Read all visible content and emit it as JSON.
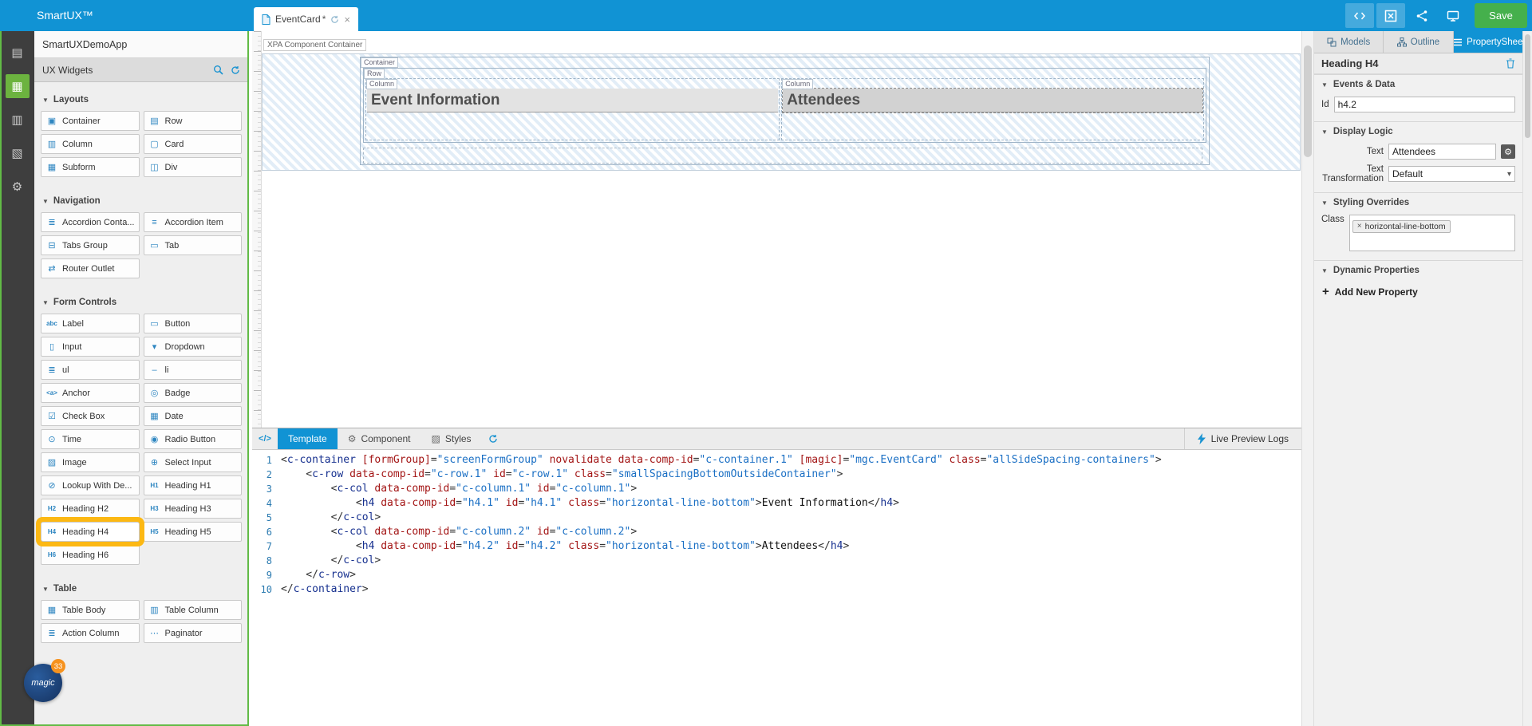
{
  "topbar": {
    "title": "SmartUX™",
    "doc_tab": {
      "label": "EventCard",
      "modified": "*"
    },
    "save_label": "Save"
  },
  "footer": {
    "logo_text": "magic",
    "badge": "33"
  },
  "widget_panel": {
    "app_name": "SmartUXDemoApp",
    "title": "UX Widgets",
    "sections": [
      {
        "label": "Layouts",
        "items": [
          {
            "label": "Container",
            "glyph": "▣",
            "icon": "container-icon"
          },
          {
            "label": "Row",
            "glyph": "▤",
            "icon": "row-icon"
          },
          {
            "label": "Column",
            "glyph": "▥",
            "icon": "column-icon"
          },
          {
            "label": "Card",
            "glyph": "▢",
            "icon": "card-icon"
          },
          {
            "label": "Subform",
            "glyph": "▦",
            "icon": "subform-icon"
          },
          {
            "label": "Div",
            "glyph": "◫",
            "icon": "div-icon"
          }
        ]
      },
      {
        "label": "Navigation",
        "items": [
          {
            "label": "Accordion Conta...",
            "glyph": "≣",
            "icon": "accordion-container-icon"
          },
          {
            "label": "Accordion Item",
            "glyph": "≡",
            "icon": "accordion-item-icon"
          },
          {
            "label": "Tabs Group",
            "glyph": "⊟",
            "icon": "tabs-group-icon"
          },
          {
            "label": "Tab",
            "glyph": "▭",
            "icon": "tab-icon"
          },
          {
            "label": "Router Outlet",
            "glyph": "⇄",
            "icon": "router-outlet-icon"
          }
        ]
      },
      {
        "label": "Form Controls",
        "items": [
          {
            "label": "Label",
            "glyph": "abc",
            "icon": "label-icon",
            "txt": true
          },
          {
            "label": "Button",
            "glyph": "▭",
            "icon": "button-icon"
          },
          {
            "label": "Input",
            "glyph": "▯",
            "icon": "input-icon"
          },
          {
            "label": "Dropdown",
            "glyph": "▾",
            "icon": "dropdown-icon"
          },
          {
            "label": "ul",
            "glyph": "≣",
            "icon": "unordered-list-icon"
          },
          {
            "label": "li",
            "glyph": "–",
            "icon": "list-item-icon"
          },
          {
            "label": "Anchor",
            "glyph": "<a>",
            "icon": "anchor-icon",
            "txt": true
          },
          {
            "label": "Badge",
            "glyph": "◎",
            "icon": "badge-icon"
          },
          {
            "label": "Check Box",
            "glyph": "☑",
            "icon": "checkbox-icon"
          },
          {
            "label": "Date",
            "glyph": "▦",
            "icon": "date-icon"
          },
          {
            "label": "Time",
            "glyph": "⊙",
            "icon": "time-icon"
          },
          {
            "label": "Radio Button",
            "glyph": "◉",
            "icon": "radio-button-icon"
          },
          {
            "label": "Image",
            "glyph": "▨",
            "icon": "image-icon"
          },
          {
            "label": "Select Input",
            "glyph": "⊕",
            "icon": "select-input-icon"
          },
          {
            "label": "Lookup With De...",
            "glyph": "⊘",
            "icon": "lookup-icon"
          },
          {
            "label": "Heading H1",
            "glyph": "H1",
            "icon": "heading1-icon",
            "txt": true
          },
          {
            "label": "Heading H2",
            "glyph": "H2",
            "icon": "heading2-icon",
            "txt": true
          },
          {
            "label": "Heading H3",
            "glyph": "H3",
            "icon": "heading3-icon",
            "txt": true
          },
          {
            "label": "Heading H4",
            "glyph": "H4",
            "icon": "heading4-icon",
            "txt": true,
            "highlight": true
          },
          {
            "label": "Heading H5",
            "glyph": "H5",
            "icon": "heading5-icon",
            "txt": true
          },
          {
            "label": "Heading H6",
            "glyph": "H6",
            "icon": "heading6-icon",
            "txt": true
          }
        ]
      },
      {
        "label": "Table",
        "items": [
          {
            "label": "Table Body",
            "glyph": "▦",
            "icon": "table-body-icon"
          },
          {
            "label": "Table Column",
            "glyph": "▥",
            "icon": "table-column-icon"
          },
          {
            "label": "Action Column",
            "glyph": "≣",
            "icon": "action-column-icon"
          },
          {
            "label": "Paginator",
            "glyph": "⋯",
            "icon": "paginator-icon"
          }
        ]
      }
    ]
  },
  "canvas": {
    "container_label": "XPA Component Container",
    "chips": {
      "container": "Container",
      "row": "Row",
      "column": "Column"
    },
    "headings": {
      "left": "Event Information",
      "right": "Attendees"
    }
  },
  "code_panel": {
    "template_tab": "Template",
    "component_tab": "Component",
    "styles_tab": "Styles",
    "live_preview": "Live Preview Logs",
    "lines": [
      [
        [
          "p",
          "<"
        ],
        [
          "t",
          "c-container"
        ],
        [
          "p",
          " "
        ],
        [
          "a",
          "[formGroup]"
        ],
        [
          "p",
          "="
        ],
        [
          "v",
          "\"screenFormGroup\""
        ],
        [
          "p",
          " "
        ],
        [
          "a",
          "novalidate"
        ],
        [
          "p",
          " "
        ],
        [
          "a",
          "data-comp-id"
        ],
        [
          "p",
          "="
        ],
        [
          "v",
          "\"c-container.1\""
        ],
        [
          "p",
          " "
        ],
        [
          "a",
          "[magic]"
        ],
        [
          "p",
          "="
        ],
        [
          "v",
          "\"mgc.EventCard\""
        ],
        [
          "p",
          " "
        ],
        [
          "a",
          "class"
        ],
        [
          "p",
          "="
        ],
        [
          "v",
          "\"allSideSpacing-containers\""
        ],
        [
          "p",
          ">"
        ]
      ],
      [
        [
          "p",
          "    <"
        ],
        [
          "t",
          "c-row"
        ],
        [
          "p",
          " "
        ],
        [
          "a",
          "data-comp-id"
        ],
        [
          "p",
          "="
        ],
        [
          "v",
          "\"c-row.1\""
        ],
        [
          "p",
          " "
        ],
        [
          "a",
          "id"
        ],
        [
          "p",
          "="
        ],
        [
          "v",
          "\"c-row.1\""
        ],
        [
          "p",
          " "
        ],
        [
          "a",
          "class"
        ],
        [
          "p",
          "="
        ],
        [
          "v",
          "\"smallSpacingBottomOutsideContainer\""
        ],
        [
          "p",
          ">"
        ]
      ],
      [
        [
          "p",
          "        <"
        ],
        [
          "t",
          "c-col"
        ],
        [
          "p",
          " "
        ],
        [
          "a",
          "data-comp-id"
        ],
        [
          "p",
          "="
        ],
        [
          "v",
          "\"c-column.1\""
        ],
        [
          "p",
          " "
        ],
        [
          "a",
          "id"
        ],
        [
          "p",
          "="
        ],
        [
          "v",
          "\"c-column.1\""
        ],
        [
          "p",
          ">"
        ]
      ],
      [
        [
          "p",
          "            <"
        ],
        [
          "t",
          "h4"
        ],
        [
          "p",
          " "
        ],
        [
          "a",
          "data-comp-id"
        ],
        [
          "p",
          "="
        ],
        [
          "v",
          "\"h4.1\""
        ],
        [
          "p",
          " "
        ],
        [
          "a",
          "id"
        ],
        [
          "p",
          "="
        ],
        [
          "v",
          "\"h4.1\""
        ],
        [
          "p",
          " "
        ],
        [
          "a",
          "class"
        ],
        [
          "p",
          "="
        ],
        [
          "v",
          "\"horizontal-line-bottom\""
        ],
        [
          "p",
          ">"
        ],
        [
          "x",
          "Event Information"
        ],
        [
          "p",
          "</"
        ],
        [
          "t",
          "h4"
        ],
        [
          "p",
          ">"
        ]
      ],
      [
        [
          "p",
          "        </"
        ],
        [
          "t",
          "c-col"
        ],
        [
          "p",
          ">"
        ]
      ],
      [
        [
          "p",
          "        <"
        ],
        [
          "t",
          "c-col"
        ],
        [
          "p",
          " "
        ],
        [
          "a",
          "data-comp-id"
        ],
        [
          "p",
          "="
        ],
        [
          "v",
          "\"c-column.2\""
        ],
        [
          "p",
          " "
        ],
        [
          "a",
          "id"
        ],
        [
          "p",
          "="
        ],
        [
          "v",
          "\"c-column.2\""
        ],
        [
          "p",
          ">"
        ]
      ],
      [
        [
          "p",
          "            <"
        ],
        [
          "t",
          "h4"
        ],
        [
          "p",
          " "
        ],
        [
          "a",
          "data-comp-id"
        ],
        [
          "p",
          "="
        ],
        [
          "v",
          "\"h4.2\""
        ],
        [
          "p",
          " "
        ],
        [
          "a",
          "id"
        ],
        [
          "p",
          "="
        ],
        [
          "v",
          "\"h4.2\""
        ],
        [
          "p",
          " "
        ],
        [
          "a",
          "class"
        ],
        [
          "p",
          "="
        ],
        [
          "v",
          "\"horizontal-line-bottom\""
        ],
        [
          "p",
          ">"
        ],
        [
          "x",
          "Attendees"
        ],
        [
          "p",
          "</"
        ],
        [
          "t",
          "h4"
        ],
        [
          "p",
          ">"
        ]
      ],
      [
        [
          "p",
          "        </"
        ],
        [
          "t",
          "c-col"
        ],
        [
          "p",
          ">"
        ]
      ],
      [
        [
          "p",
          "    </"
        ],
        [
          "t",
          "c-row"
        ],
        [
          "p",
          ">"
        ]
      ],
      [
        [
          "p",
          "</"
        ],
        [
          "t",
          "c-container"
        ],
        [
          "p",
          ">"
        ]
      ]
    ]
  },
  "right_panel": {
    "tabs": [
      {
        "label": "Models"
      },
      {
        "label": "Outline"
      },
      {
        "label": "PropertyShee"
      }
    ],
    "header": "Heading H4",
    "events_section": "Events & Data",
    "id_label": "Id",
    "id_value": "h4.2",
    "display_section": "Display Logic",
    "text_label": "Text",
    "text_value": "Attendees",
    "transform_label": "Text Transformation",
    "transform_value": "Default",
    "styling_section": "Styling Overrides",
    "class_label": "Class",
    "class_chip": "horizontal-line-bottom",
    "dynamic_section": "Dynamic Properties",
    "add_plus": "+",
    "add_label": "Add New Property"
  }
}
